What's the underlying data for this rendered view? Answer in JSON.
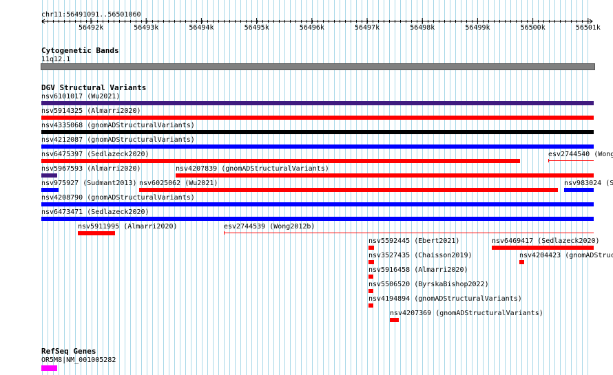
{
  "ruler": {
    "position_label": "chr11:56491091..56501060",
    "ticks": [
      "56492k",
      "56493k",
      "56494k",
      "56495k",
      "56496k",
      "56497k",
      "56498k",
      "56499k",
      "56500k",
      "56501k"
    ]
  },
  "cytoband": {
    "title": "Cytogenetic Bands",
    "band": "11q12.1",
    "color": "#808080"
  },
  "dgv": {
    "title": "DGV Structural Variants",
    "colors": {
      "loss": "#ff0000",
      "gain": "#0000ff",
      "complex": "#000000",
      "other": "#3f1a7f"
    },
    "variants": [
      {
        "id": "v1",
        "label": "nsv6101017 (Wu2021)",
        "color": "#3f1a7f"
      },
      {
        "id": "v2",
        "label": "nsv5914325 (Almarri2020)",
        "color": "#ff0000"
      },
      {
        "id": "v3",
        "label": "nsv4335068 (gnomADStructuralVariants)",
        "color": "#000000"
      },
      {
        "id": "v4",
        "label": "nsv4212087 (gnomADStructuralVariants)",
        "color": "#0000ff"
      },
      {
        "id": "v5",
        "label": "nsv6475397 (Sedlazeck2020)",
        "color": "#ff0000"
      },
      {
        "id": "v6",
        "label": "esv2744540 (Wong",
        "color": "#ff0000"
      },
      {
        "id": "v7",
        "label": "nsv5967593 (Almarri2020)",
        "color": "#3f1a7f"
      },
      {
        "id": "v8",
        "label": "nsv4207839 (gnomADStructuralVariants)",
        "color": "#ff0000"
      },
      {
        "id": "v9",
        "label": "nsv975927 (Sudmant2013)",
        "color": "#0000ff"
      },
      {
        "id": "v10",
        "label": "nsv6025062 (Wu2021)",
        "color": "#ff0000"
      },
      {
        "id": "v11",
        "label": "nsv983024 (S",
        "color": "#0000ff"
      },
      {
        "id": "v12",
        "label": "nsv4208790 (gnomADStructuralVariants)",
        "color": "#0000ff"
      },
      {
        "id": "v13",
        "label": "nsv6473471 (Sedlazeck2020)",
        "color": "#0000ff"
      },
      {
        "id": "v14",
        "label": "nsv5911995 (Almarri2020)",
        "color": "#ff0000"
      },
      {
        "id": "v15",
        "label": "esv2744539 (Wong2012b)",
        "color": "#ff0000"
      },
      {
        "id": "v16",
        "label": "nsv5592445 (Ebert2021)",
        "color": "#ff0000"
      },
      {
        "id": "v17",
        "label": "nsv6469417 (Sedlazeck2020)",
        "color": "#ff0000"
      },
      {
        "id": "v18",
        "label": "nsv3527435 (Chaisson2019)",
        "color": "#ff0000"
      },
      {
        "id": "v19",
        "label": "nsv4204423 (gnomADStruc",
        "color": "#ff0000"
      },
      {
        "id": "v20",
        "label": "nsv5916458 (Almarri2020)",
        "color": "#ff0000"
      },
      {
        "id": "v21",
        "label": "nsv5506520 (ByrskaBishop2022)",
        "color": "#ff0000"
      },
      {
        "id": "v22",
        "label": "nsv4194894 (gnomADStructuralVariants)",
        "color": "#ff0000"
      },
      {
        "id": "v23",
        "label": "nsv4207369 (gnomADStructuralVariants)",
        "color": "#ff0000"
      }
    ]
  },
  "refseq": {
    "title": "RefSeq Genes",
    "gene_label": "OR5M8|NM_001005282",
    "color": "#ff00ff"
  },
  "grid_color": "#a8d8e8"
}
